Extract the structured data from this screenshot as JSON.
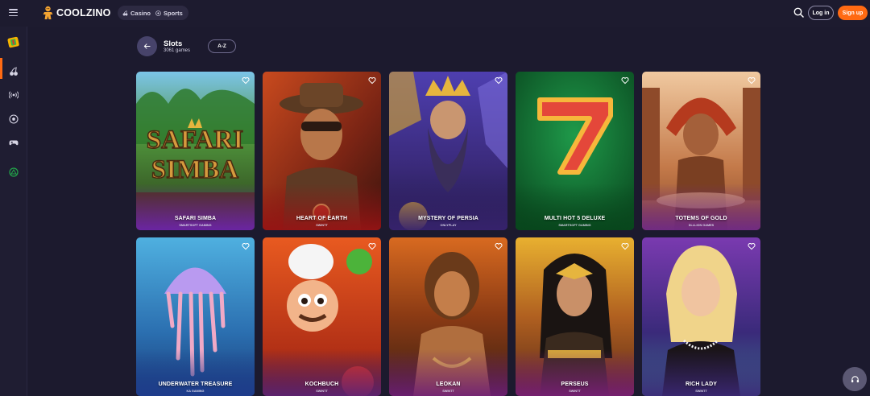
{
  "header": {
    "logo_text": "COOLZINO",
    "nav": [
      {
        "label": "Casino",
        "icon": "cherries-icon"
      },
      {
        "label": "Sports",
        "icon": "ball-icon"
      }
    ],
    "login_label": "Log in",
    "signup_label": "Sign up",
    "accent_color": "#ff6a13"
  },
  "sidebar": {
    "items": [
      {
        "icon": "slots-lobby-icon",
        "active": true
      },
      {
        "icon": "cherries-icon"
      },
      {
        "icon": "live-broadcast-icon"
      },
      {
        "icon": "soccer-ball-icon"
      },
      {
        "icon": "gamepad-icon"
      },
      {
        "icon": "esports-icon"
      }
    ]
  },
  "section": {
    "title": "Slots",
    "count": "3061 games",
    "sort_label": "A-Z"
  },
  "games": [
    {
      "title": "Safari Simba",
      "provider": "Smartsoft Gaming"
    },
    {
      "title": "Heart of Earth",
      "provider": "Swintt"
    },
    {
      "title": "Mystery of Persia",
      "provider": "Onlyplay"
    },
    {
      "title": "Multi Hot 5 Deluxe",
      "provider": "Smartsoft Gaming"
    },
    {
      "title": "Totems of Gold",
      "provider": "Dlllion Games"
    },
    {
      "title": "Underwater Treasure",
      "provider": "KA Gaming"
    },
    {
      "title": "Kochbuch",
      "provider": "Swintt"
    },
    {
      "title": "Leokan",
      "provider": "Swintt"
    },
    {
      "title": "Perseus",
      "provider": "Swintt"
    },
    {
      "title": "Rich Lady",
      "provider": "Swintt"
    }
  ]
}
